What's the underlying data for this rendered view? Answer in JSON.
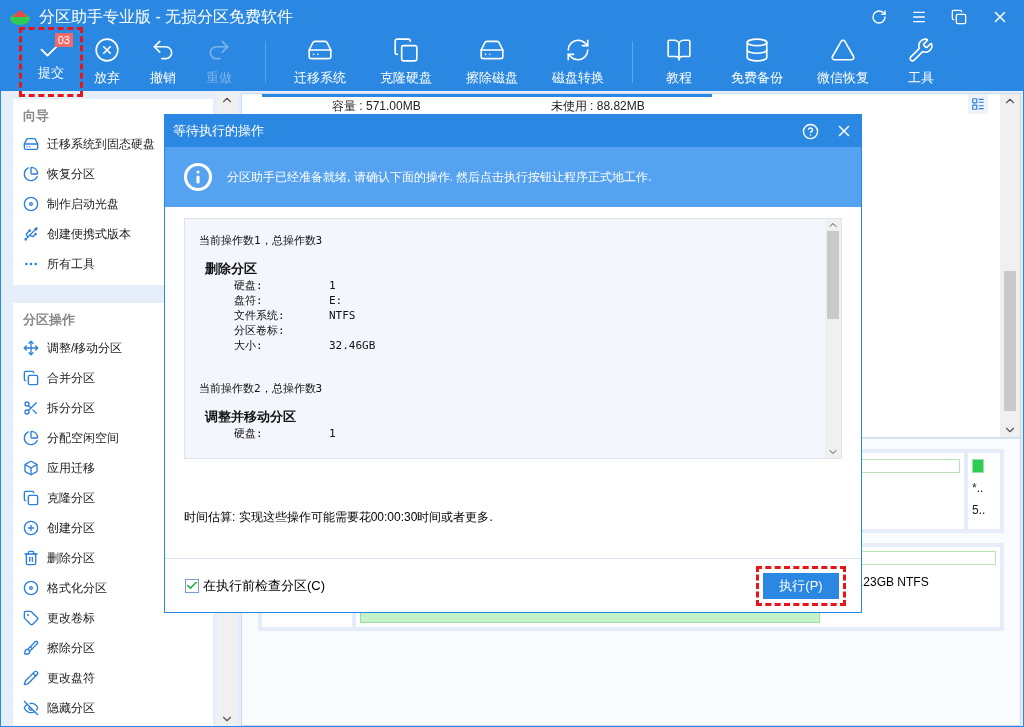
{
  "window": {
    "title": "分区助手专业版 - 无损分区免费软件"
  },
  "toolbar": {
    "groups": [
      {
        "items": [
          {
            "label": "提交",
            "disabled": false,
            "badge": "03",
            "highlighted": true
          },
          {
            "label": "放弃",
            "disabled": false,
            "highlighted": false
          },
          {
            "label": "撤销",
            "disabled": false,
            "highlighted": false
          },
          {
            "label": "重做",
            "disabled": true,
            "highlighted": false
          }
        ]
      },
      {
        "items": [
          {
            "label": "迁移系统",
            "disabled": false,
            "highlighted": false
          },
          {
            "label": "克隆硬盘",
            "disabled": false,
            "highlighted": false
          },
          {
            "label": "擦除磁盘",
            "disabled": false,
            "highlighted": false
          },
          {
            "label": "磁盘转换",
            "disabled": false,
            "highlighted": false
          }
        ]
      },
      {
        "items": [
          {
            "label": "教程",
            "disabled": false,
            "highlighted": false
          },
          {
            "label": "免费备份",
            "disabled": false,
            "highlighted": false
          },
          {
            "label": "微信恢复",
            "disabled": false,
            "highlighted": false
          },
          {
            "label": "工具",
            "disabled": false,
            "highlighted": false
          }
        ]
      }
    ]
  },
  "sidebar": {
    "sections": [
      {
        "title": "向导",
        "items": [
          "迁移系统到固态硬盘",
          "恢复分区",
          "制作启动光盘",
          "创建便携式版本",
          "所有工具"
        ]
      },
      {
        "title": "分区操作",
        "items": [
          "调整/移动分区",
          "合并分区",
          "拆分分区",
          "分配空闲空间",
          "应用迁移",
          "克隆分区",
          "创建分区",
          "删除分区",
          "格式化分区",
          "更改卷标",
          "擦除分区",
          "更改盘符",
          "隐藏分区"
        ]
      }
    ]
  },
  "main": {
    "partition": {
      "capacity": "容量 : 571.00MB",
      "unused": "未使用 : 88.82MB"
    },
    "disks": [
      {
        "side_texts": [
          "*..",
          "5.."
        ]
      },
      {
        "partition_text": ".23GB NTFS"
      }
    ]
  },
  "dialog": {
    "title": "等待执行的操作",
    "info": "分区助手已经准备就绪, 请确认下面的操作. 然后点击执行按钮让程序正式地工作.",
    "log": [
      {
        "header": "当前操作数1，总操作数3",
        "title": "删除分区",
        "fields": [
          {
            "label": "硬盘:",
            "value": "1"
          },
          {
            "label": "盘符:",
            "value": "E:"
          },
          {
            "label": "文件系统:",
            "value": "NTFS"
          },
          {
            "label": "分区卷标:"
          },
          {
            "label": "大小:",
            "value": "32.46GB"
          }
        ]
      },
      {
        "header": "当前操作数2，总操作数3",
        "title": "调整并移动分区",
        "fields": [
          {
            "label": "硬盘:",
            "value": "1"
          }
        ]
      }
    ],
    "estimate": "时间估算: 实现这些操作可能需要花00:00:30时间或者更多.",
    "check_before": {
      "label": "在执行前检查分区(C)",
      "checked": true
    },
    "button": {
      "label": "执行(P)",
      "highlighted": true
    }
  }
}
